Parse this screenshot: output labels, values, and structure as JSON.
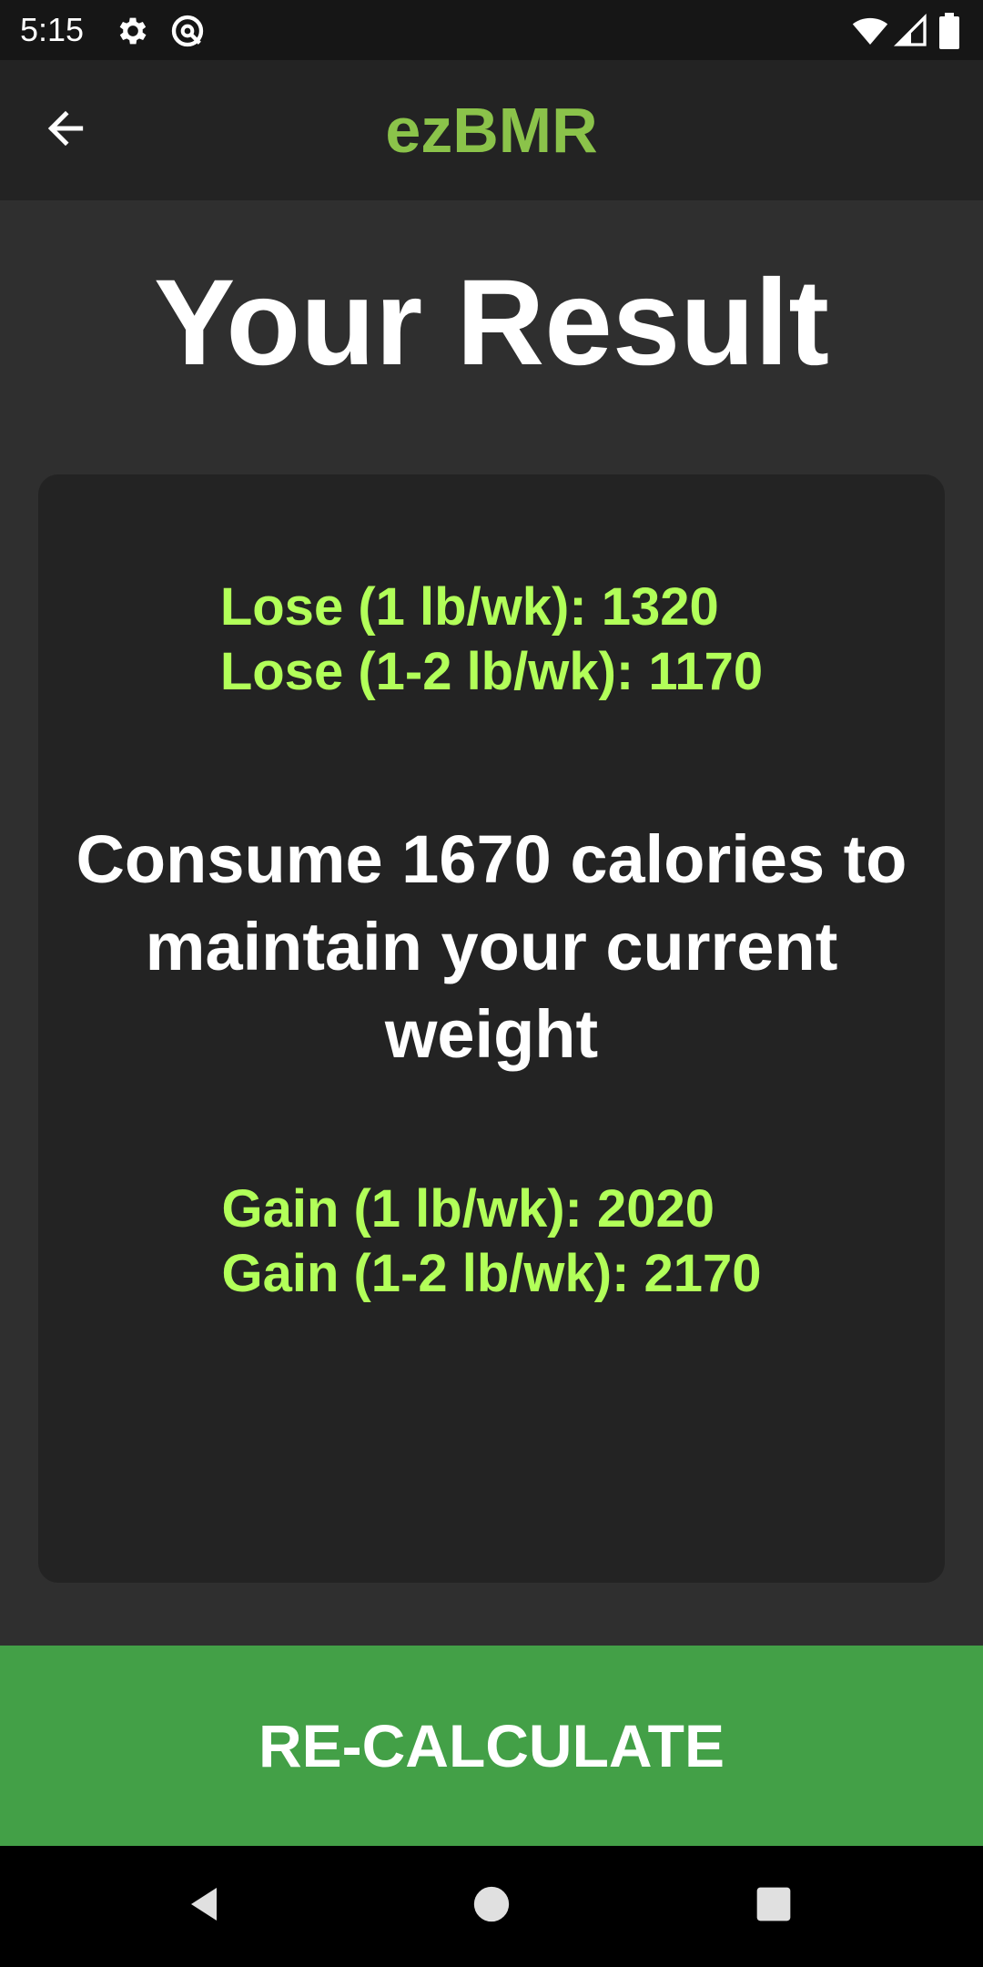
{
  "status_bar": {
    "time": "5:15",
    "left_icons": [
      "gear-icon",
      "no-signal-circle-icon"
    ],
    "right_icons": [
      "wifi-icon",
      "cell-signal-icon",
      "battery-icon"
    ]
  },
  "app_bar": {
    "title": "ezBMR",
    "back_icon": "arrow-left-icon",
    "title_color": "#8bc34a"
  },
  "heading": "Your Result",
  "results": {
    "lose": [
      "Lose (1 lb/wk): 1320",
      "Lose (1-2 lb/wk): 1170"
    ],
    "maintain": "Consume 1670 calories to maintain your current weight",
    "gain": [
      "Gain (1 lb/wk): 2020",
      "Gain (1-2 lb/wk): 2170"
    ],
    "goal_color": "#b2ff59"
  },
  "recalculate_button": {
    "label": "RE-CALCULATE",
    "color": "#43a047"
  },
  "nav_bar": {
    "buttons": [
      "back-triangle-icon",
      "home-circle-icon",
      "recents-square-icon"
    ]
  }
}
